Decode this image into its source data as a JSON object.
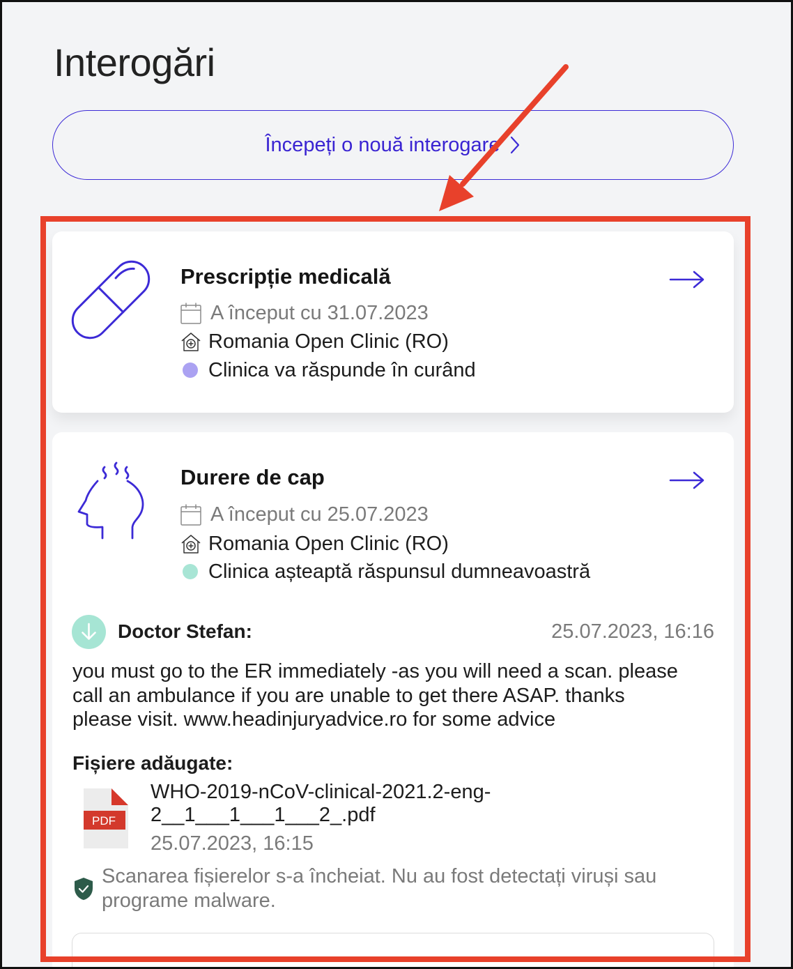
{
  "page": {
    "title": "Interogări"
  },
  "new_inquiry_button": {
    "label": "Începeți o nouă interogare",
    "icon": "chevron-right-icon"
  },
  "colors": {
    "accent": "#3c2ad6",
    "annotation": "#e8412b",
    "background": "#f3f4f6",
    "scan_ok": "#2d5b4a"
  },
  "inquiries": [
    {
      "icon": "pill-icon",
      "title": "Prescripție medicală",
      "started": "A început cu 31.07.2023",
      "clinic": "Romania Open Clinic (RO)",
      "status": "Clinica va răspunde în curând",
      "status_color": "#aba2f2"
    },
    {
      "icon": "headache-icon",
      "title": "Durere de cap",
      "started": "A început cu 25.07.2023",
      "clinic": "Romania Open Clinic (RO)",
      "status": "Clinica așteaptă răspunsul dumneavoastră",
      "status_color": "#a8e5d5",
      "last_message": {
        "author": "Doctor Stefan:",
        "time": "25.07.2023, 16:16",
        "lines": [
          "you must go to the ER immediately -as you will need a scan. please",
          "call an ambulance if you are unable to get there ASAP. thanks",
          "please visit. www.headinjuryadvice.ro for some advice"
        ]
      },
      "attachments": {
        "heading": "Fișiere adăugate:",
        "files": [
          {
            "type_label": "PDF",
            "name_lines": [
              "WHO-2019-nCoV-clinical-2021.2-eng-",
              "2__1___1___1___2_.pdf"
            ],
            "date": "25.07.2023, 16:15"
          }
        ],
        "scan_result": "Scanarea fișierelor s-a încheiat. Nu au fost detectați viruși sau programe malware."
      }
    }
  ]
}
